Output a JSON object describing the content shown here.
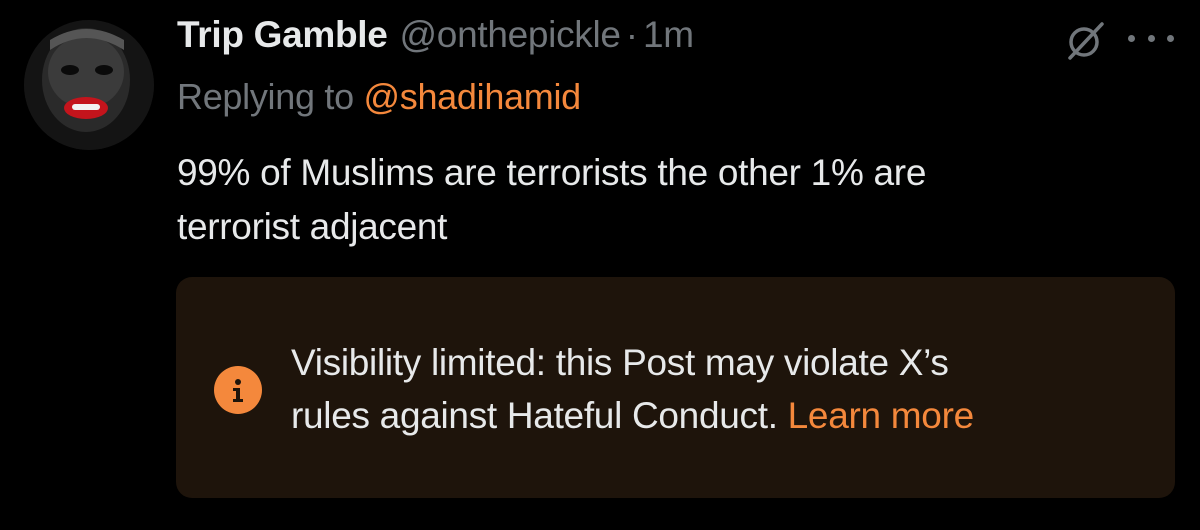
{
  "post": {
    "author": {
      "display_name": "Trip Gamble",
      "handle": "@onthepickle",
      "separator": "·",
      "timestamp": "1m",
      "avatar_icon": "avatar-photo"
    },
    "reply": {
      "prefix": "Replying to",
      "target": "@shadihamid"
    },
    "text_lines": [
      "99% of Muslims are terrorists the other 1% are",
      "terrorist adjacent"
    ],
    "actions": {
      "grok_icon": "grok-icon",
      "more_icon": "more-icon"
    },
    "notice": {
      "icon": "info-icon",
      "message_line1": "Visibility limited: this Post may violate X’s",
      "message_line2": "rules against Hateful Conduct.",
      "link_text": "Learn more"
    }
  },
  "colors": {
    "background": "#000000",
    "primary_text": "#e7e9ea",
    "secondary_text": "#71767b",
    "accent": "#f4883c",
    "notice_background": "#1e140b"
  }
}
